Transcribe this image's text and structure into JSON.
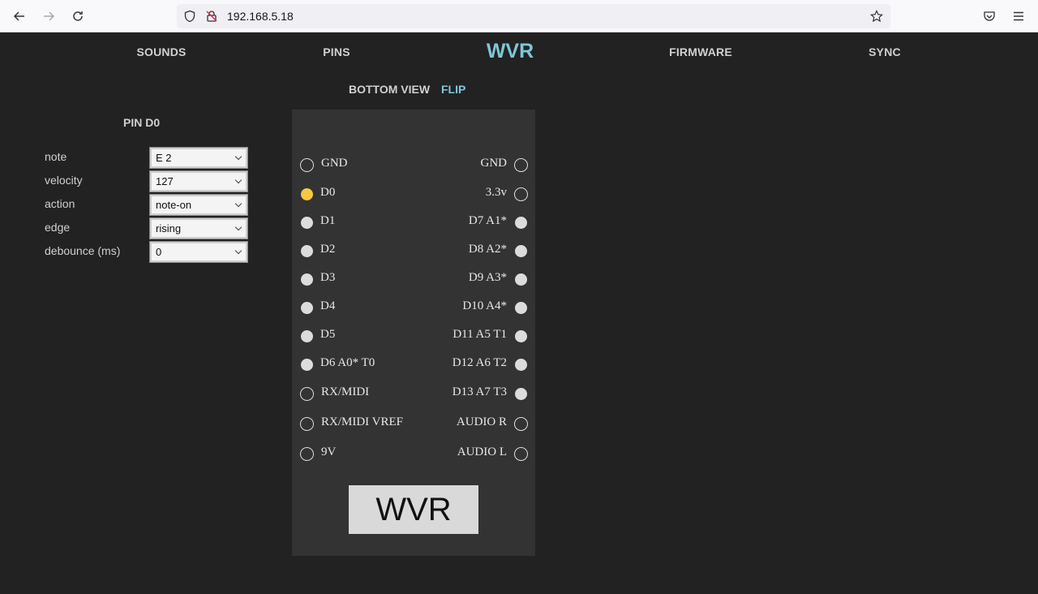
{
  "browser": {
    "url": "192.168.5.18"
  },
  "nav": {
    "sounds": "SOUNDS",
    "pins": "PINS",
    "logo": "WVR",
    "firmware": "FIRMWARE",
    "sync": "SYNC"
  },
  "view": {
    "label": "BOTTOM VIEW",
    "flip": "FLIP"
  },
  "pin_config": {
    "title": "PIN D0",
    "fields": [
      {
        "label": "note",
        "value": "E 2"
      },
      {
        "label": "velocity",
        "value": "127"
      },
      {
        "label": "action",
        "value": "note-on"
      },
      {
        "label": "edge",
        "value": "rising"
      },
      {
        "label": "debounce (ms)",
        "value": "0"
      }
    ]
  },
  "board": {
    "left_pins": [
      {
        "label": "GND",
        "style": "hollow"
      },
      {
        "label": "D0",
        "style": "active"
      },
      {
        "label": "D1",
        "style": "solid"
      },
      {
        "label": "D2",
        "style": "solid"
      },
      {
        "label": "D3",
        "style": "solid"
      },
      {
        "label": "D4",
        "style": "solid"
      },
      {
        "label": "D5",
        "style": "solid"
      },
      {
        "label": "D6 A0* T0",
        "style": "solid"
      },
      {
        "label": "RX/MIDI",
        "style": "hollow"
      },
      {
        "label": "RX/MIDI VREF",
        "style": "hollow"
      },
      {
        "label": "9V",
        "style": "hollow"
      }
    ],
    "right_pins": [
      {
        "label": "GND",
        "style": "hollow"
      },
      {
        "label": "3.3v",
        "style": "hollow"
      },
      {
        "label": "D7 A1*",
        "style": "solid"
      },
      {
        "label": "D8 A2*",
        "style": "solid"
      },
      {
        "label": "D9 A3*",
        "style": "solid"
      },
      {
        "label": "D10 A4*",
        "style": "solid"
      },
      {
        "label": "D11 A5 T1",
        "style": "solid"
      },
      {
        "label": "D12 A6 T2",
        "style": "solid"
      },
      {
        "label": "D13 A7 T3",
        "style": "solid"
      },
      {
        "label": "AUDIO R",
        "style": "hollow"
      },
      {
        "label": "AUDIO L",
        "style": "hollow"
      }
    ],
    "logo": "WVR"
  },
  "colors": {
    "accent": "#7fc7d6",
    "active_pin": "#f5c842",
    "background": "#222222",
    "board": "#333333"
  }
}
